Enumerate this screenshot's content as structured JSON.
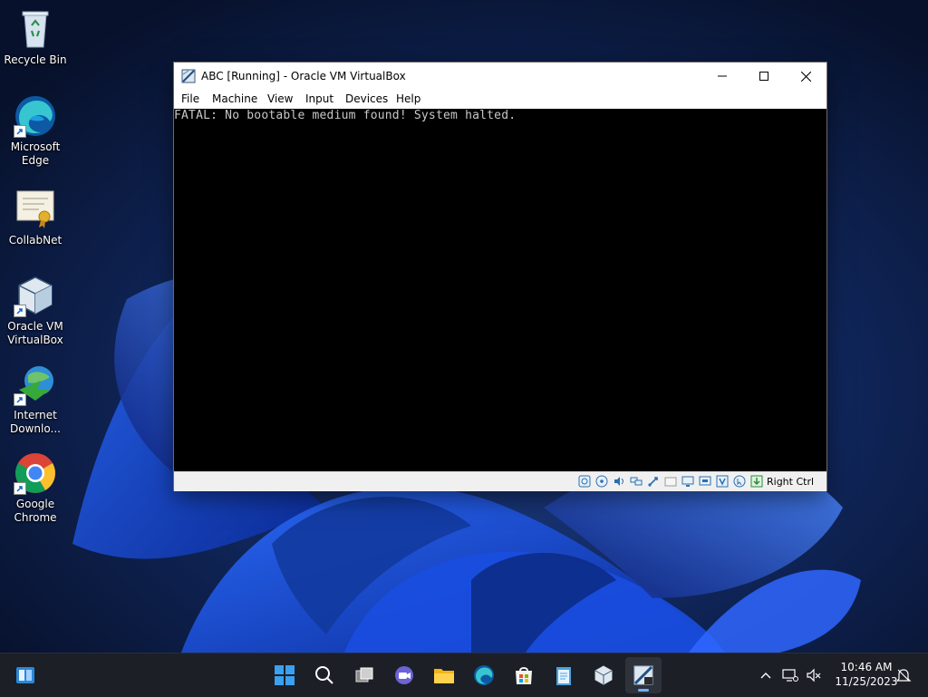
{
  "desktop": {
    "icons": [
      {
        "label": "Recycle Bin",
        "icon": "recycle-bin-icon"
      },
      {
        "label": "Microsoft\nEdge",
        "icon": "edge-icon"
      },
      {
        "label": "CollabNet",
        "icon": "certificate-icon"
      },
      {
        "label": "Oracle VM\nVirtualBox",
        "icon": "virtualbox-icon"
      },
      {
        "label": "Internet\nDownlo...",
        "icon": "internet-download-manager-icon"
      },
      {
        "label": "Google\nChrome",
        "icon": "chrome-icon"
      }
    ]
  },
  "window": {
    "title": "ABC [Running] - Oracle VM VirtualBox",
    "menu": [
      "File",
      "Machine",
      "View",
      "Input",
      "Devices",
      "Help"
    ],
    "console_text": "FATAL: No bootable medium found! System halted.",
    "host_key": "Right Ctrl",
    "status_icons": [
      "hard-disk-icon",
      "optical-drive-icon",
      "audio-icon",
      "network-icon",
      "usb-icon",
      "shared-folder-icon",
      "display-icon",
      "recording-icon",
      "vt-x-icon",
      "mouse-integration-icon",
      "keyboard-capture-icon"
    ]
  },
  "taskbar": {
    "apps": [
      "widgets-icon",
      "start-icon",
      "search-icon",
      "task-view-icon",
      "teams-chat-icon",
      "file-explorer-icon",
      "edge-icon",
      "store-icon",
      "notepad-icon",
      "virtualbox-icon",
      "virtualbox-vm-icon"
    ],
    "clock": {
      "time": "10:46 AM",
      "date": "11/25/2023"
    }
  },
  "colors": {
    "accent": "#0078d4",
    "wallpaper": "#0b1a3a",
    "taskbar": "#1c1f26"
  }
}
